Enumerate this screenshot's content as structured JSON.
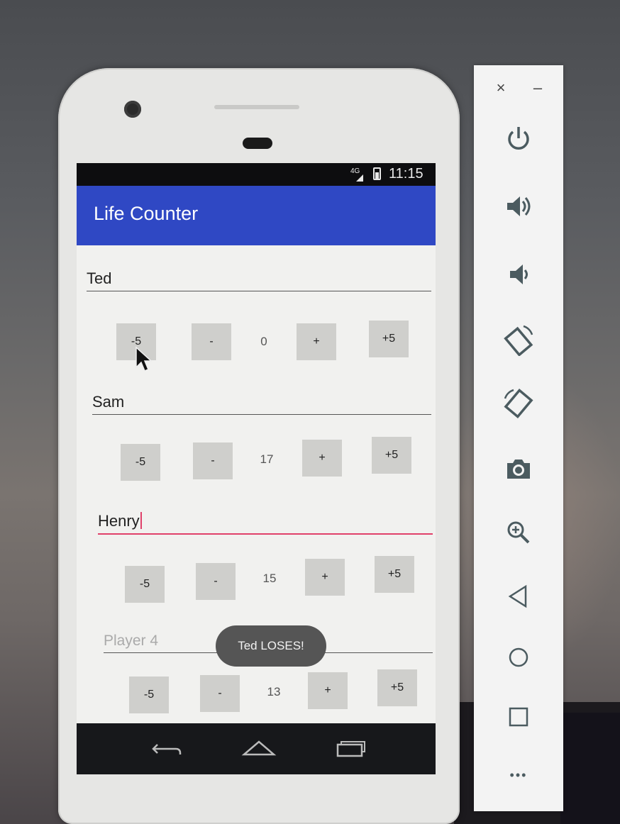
{
  "app": {
    "title": "Life Counter",
    "status_time": "11:15",
    "network": "4G"
  },
  "players": [
    {
      "name": "Ted",
      "count": "0"
    },
    {
      "name": "Sam",
      "count": "17"
    },
    {
      "name": "Henry",
      "count": "15"
    },
    {
      "name_hint": "Player 4",
      "count": "13"
    }
  ],
  "buttons": {
    "minus5": "-5",
    "minus1": "-",
    "plus1": "+",
    "plus5": "+5"
  },
  "toast": "Ted LOSES!",
  "toolbar": {
    "close": "×",
    "minimize": "–",
    "more": "•••",
    "items": [
      "power-icon",
      "volume-up-icon",
      "volume-down-icon",
      "rotate-left-icon",
      "rotate-right-icon",
      "camera-icon",
      "zoom-icon",
      "back-icon",
      "home-icon",
      "overview-icon"
    ]
  },
  "colors": {
    "app_bar": "#2f48c4",
    "accent": "#e0406a"
  }
}
